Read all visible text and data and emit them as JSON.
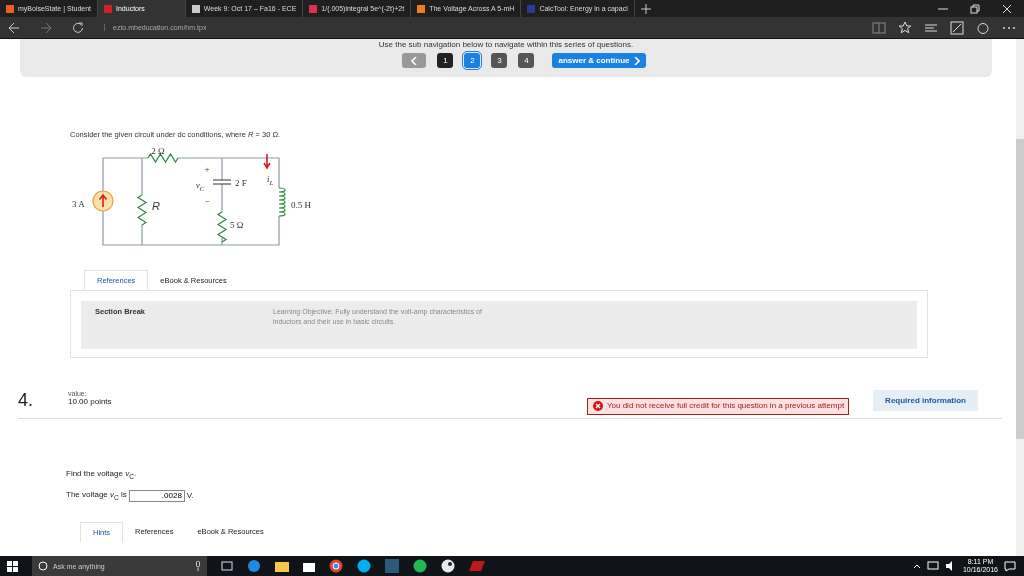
{
  "browser": {
    "tabs": [
      {
        "label": "myBoiseState | Student",
        "selected": false,
        "color": "#e8601c"
      },
      {
        "label": "Inductors",
        "selected": true,
        "color": "#d0202a"
      },
      {
        "label": "Week 9: Oct 17 – Fa16 - ECE",
        "selected": false,
        "color": "#c9c9c9"
      },
      {
        "label": "1/(.005)integral 5e^(-2t)+2t",
        "selected": false,
        "color": "#e0304a"
      },
      {
        "label": "The Voltage Across A 5-mH",
        "selected": false,
        "color": "#f07d1a"
      },
      {
        "label": "CalcTool: Energy in a capaci",
        "selected": false,
        "color": "#2a3a9a"
      }
    ],
    "address": "ezto.mheducation.com/hm.tpx"
  },
  "nav": {
    "hint": "Use the sub navigation below to navigate within this series of questions.",
    "pages": [
      {
        "label": "1",
        "selected": false,
        "color": "#222222"
      },
      {
        "label": "2",
        "selected": true,
        "color": "#1a82e2"
      },
      {
        "label": "3",
        "selected": false,
        "color": "#555555"
      },
      {
        "label": "4",
        "selected": false,
        "color": "#555555"
      }
    ],
    "continue": "answer & continue"
  },
  "intro": {
    "text": "Consider the given circuit under dc conditions, where *R* = 30 Ω.",
    "circuit_labels": [
      {
        "kind": "res",
        "text": "2 Ω"
      },
      {
        "kind": "plus",
        "text": "+"
      },
      {
        "kind": "vc",
        "text": "v$_{C}$"
      },
      {
        "kind": "cap",
        "text": "2 F"
      },
      {
        "kind": "minus",
        "text": "−"
      },
      {
        "kind": "il",
        "text": "i$_{L}$"
      },
      {
        "kind": "src",
        "text": "3 A"
      },
      {
        "kind": "r",
        "text": "R"
      },
      {
        "kind": "ind",
        "text": "0.5 H"
      },
      {
        "kind": "res5",
        "text": "5 Ω"
      }
    ],
    "tabs": [
      {
        "label": "References",
        "selected": true
      },
      {
        "label": "eBook & Resources",
        "selected": false
      }
    ],
    "section": {
      "title": "Section Break",
      "text": "Learning Objective: Fully understand the volt-amp characteristics of inductors and their use in basic circuits."
    }
  },
  "question": {
    "number": "4.",
    "value_label": "value:",
    "points": "10.00 points",
    "alert": "You did not receive full credit for this question in a previous attempt",
    "required": "Required information",
    "prompt": "Find the voltage *v*$_{C}$.",
    "answer_before": "The voltage *v*$_{C}$ is",
    "answer": ".0028",
    "answer_after": "V.",
    "tabs": [
      {
        "label": "Hints",
        "selected": true
      },
      {
        "label": "References",
        "selected": false
      },
      {
        "label": "eBook & Resources",
        "selected": false
      }
    ]
  },
  "taskbar": {
    "search": "Ask me anything",
    "time": "8:11 PM",
    "date": "10/16/2016"
  }
}
